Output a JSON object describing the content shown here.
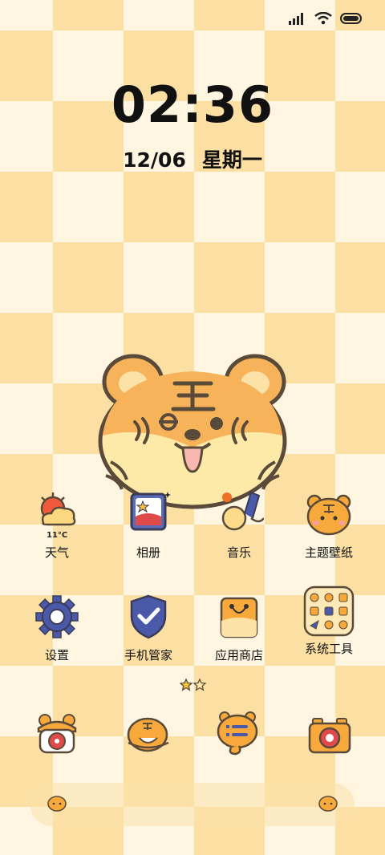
{
  "status_bar": {
    "signal_icon": "signal-bars-icon",
    "wifi_icon": "wifi-icon",
    "battery_icon": "battery-icon"
  },
  "clock": {
    "time": "02:36",
    "date": "12/06",
    "weekday": "星期一"
  },
  "apps_row1": [
    {
      "label": "天气",
      "icon": "weather-icon",
      "temp": "11°C"
    },
    {
      "label": "相册",
      "icon": "gallery-icon"
    },
    {
      "label": "音乐",
      "icon": "music-icon"
    },
    {
      "label": "主题壁纸",
      "icon": "theme-wallpaper-icon"
    }
  ],
  "apps_row2": [
    {
      "label": "设置",
      "icon": "gear-icon"
    },
    {
      "label": "手机管家",
      "icon": "shield-icon"
    },
    {
      "label": "应用商店",
      "icon": "app-store-icon"
    },
    {
      "label": "系统工具",
      "icon": "system-tools-folder-icon"
    }
  ],
  "page_indicator": {
    "pages": 2,
    "active": 0
  },
  "dock_apps": [
    {
      "icon": "phone-icon"
    },
    {
      "icon": "messages-icon"
    },
    {
      "icon": "chat-icon"
    },
    {
      "icon": "camera-icon"
    }
  ],
  "colors": {
    "orange": "#F7A93B",
    "cream": "#FEF6E0",
    "check": "#FCDFA3",
    "outline": "#5A4A3A"
  }
}
